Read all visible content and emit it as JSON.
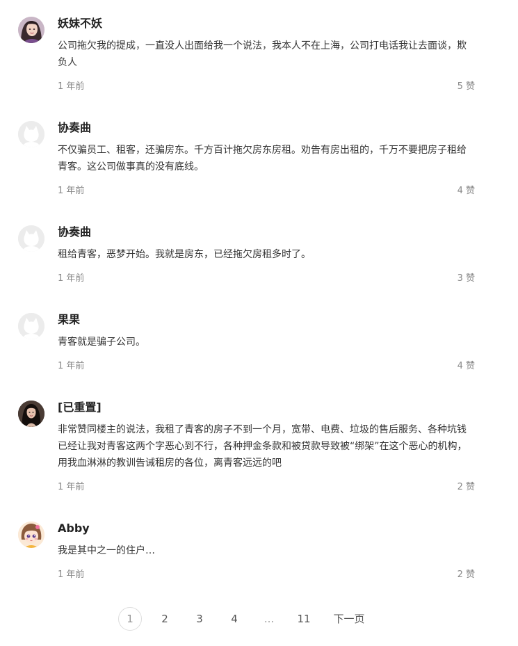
{
  "comments": [
    {
      "username": "妖妹不妖",
      "avatar": "avatar-photo-woman",
      "text": "公司拖欠我的提成，一直没人出面给我一个说法，我本人不在上海，公司打电话我让去面谈，欺负人",
      "time": "1 年前",
      "likes": "5 赞"
    },
    {
      "username": "协奏曲",
      "avatar": "default-avatar-icon",
      "text": "不仅骗员工、租客，还骗房东。千方百计拖欠房东房租。劝告有房出租的，千万不要把房子租给青客。这公司做事真的没有底线。",
      "time": "1 年前",
      "likes": "4 赞"
    },
    {
      "username": "协奏曲",
      "avatar": "default-avatar-icon",
      "text": "租给青客，恶梦开始。我就是房东，已经拖欠房租多时了。",
      "time": "1 年前",
      "likes": "3 赞"
    },
    {
      "username": "果果",
      "avatar": "default-avatar-icon",
      "text": "青客就是骗子公司。",
      "time": "1 年前",
      "likes": "4 赞"
    },
    {
      "username": "[已重置]",
      "avatar": "avatar-photo-dark-hair",
      "text": "非常赞同楼主的说法，我租了青客的房子不到一个月，宽带、电费、垃圾的售后服务、各种坑钱已经让我对青客这两个字恶心到不行，各种押金条款和被贷款导致被“绑架”在这个恶心的机构，用我血淋淋的教训告诫租房的各位，离青客远远的吧",
      "time": "1 年前",
      "likes": "2 赞"
    },
    {
      "username": "Abby",
      "avatar": "avatar-cartoon-girl",
      "text": "我是其中之一的住户…",
      "time": "1 年前",
      "likes": "2 赞"
    }
  ],
  "pagination": {
    "pages": [
      "1",
      "2",
      "3",
      "4",
      "...",
      "11"
    ],
    "current": "1",
    "next_label": "下一页"
  }
}
